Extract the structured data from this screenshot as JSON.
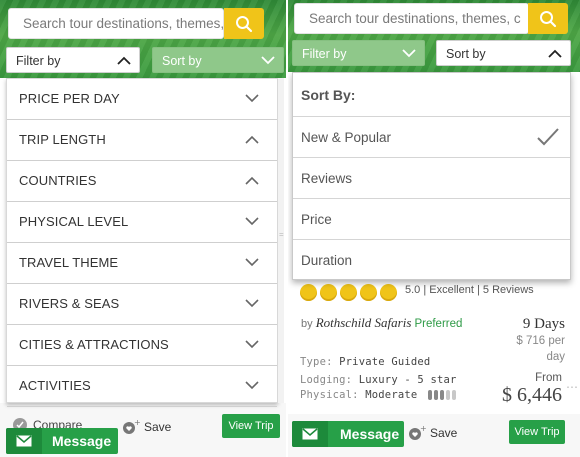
{
  "search": {
    "placeholder_left": "Search tour destinations, themes, c",
    "placeholder_right": "Search tour destinations, themes, c"
  },
  "left": {
    "filter_label": "Filter by",
    "sort_label": "Sort by",
    "filters": [
      {
        "label": "PRICE PER DAY",
        "state": "collapsed"
      },
      {
        "label": "TRIP LENGTH",
        "state": "expanded"
      },
      {
        "label": "COUNTRIES",
        "state": "expanded"
      },
      {
        "label": "PHYSICAL LEVEL",
        "state": "collapsed"
      },
      {
        "label": "TRAVEL THEME",
        "state": "collapsed"
      },
      {
        "label": "RIVERS & SEAS",
        "state": "collapsed"
      },
      {
        "label": "CITIES & ATTRACTIONS",
        "state": "collapsed"
      },
      {
        "label": "ACTIVITIES",
        "state": "collapsed"
      }
    ],
    "compare_label": "Compare",
    "message_label": "Message",
    "save_label": "Save",
    "view_trip_label": "View Trip"
  },
  "right": {
    "filter_label": "Filter by",
    "sort_label": "Sort by",
    "sort_heading": "Sort By:",
    "sort_options": [
      {
        "label": "New & Popular",
        "selected": true
      },
      {
        "label": "Reviews",
        "selected": false
      },
      {
        "label": "Price",
        "selected": false
      },
      {
        "label": "Duration",
        "selected": false
      }
    ],
    "trip": {
      "rating_value": "5.0",
      "rating_word": "Excellent",
      "reviews": "5 Reviews",
      "by": "by",
      "operator": "Rothschild Safaris",
      "badge": "Preferred",
      "duration": "9 Days",
      "per_day_price": "$ 716 per",
      "per_day_unit": "day",
      "type_label": "Type:",
      "type_value": "Private Guided",
      "lodging_label": "Lodging:",
      "lodging_value": "Luxury - 5 star",
      "physical_label": "Physical:",
      "physical_value": "Moderate",
      "physical_level": 3,
      "physical_max": 5,
      "from_label": "From",
      "price": "$ 6,446",
      "stars": 5
    },
    "message_label": "Message",
    "save_label": "Save",
    "view_trip_label": "View Trip"
  },
  "colors": {
    "brand_green": "#27a048",
    "search_yellow": "#f0c419",
    "preferred_green": "#2e9a46"
  },
  "icons": {
    "search": "search-icon",
    "chevron": "chevron-down-icon",
    "check": "checkmark-icon",
    "envelope": "envelope-icon",
    "save": "save-heart-icon"
  }
}
